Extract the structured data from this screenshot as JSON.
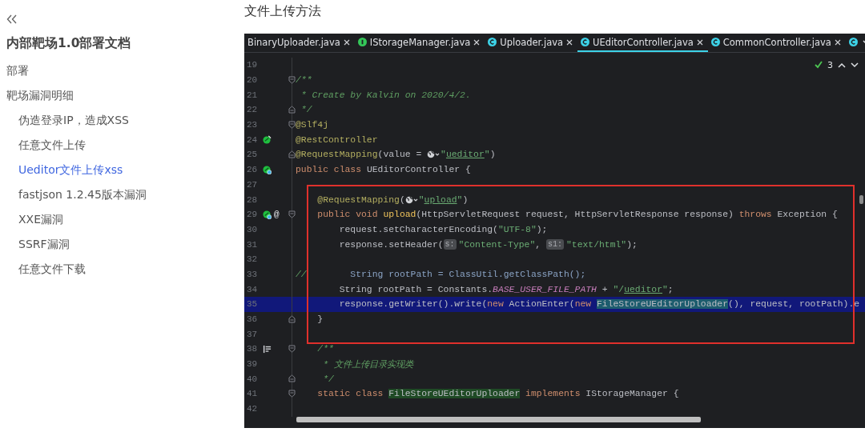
{
  "sidebar": {
    "title": "内部靶场1.0部署文档",
    "items": [
      {
        "label": "部署",
        "selected": false
      },
      {
        "label": "靶场漏洞明细",
        "selected": false,
        "children": [
          {
            "label": "伪造登录IP，造成XSS",
            "selected": false
          },
          {
            "label": "任意文件上传",
            "selected": false
          },
          {
            "label": "Ueditor文件上传xss",
            "selected": true
          },
          {
            "label": "fastjson 1.2.45版本漏洞",
            "selected": false
          },
          {
            "label": "XXE漏洞",
            "selected": false
          },
          {
            "label": "SSRF漏洞",
            "selected": false
          },
          {
            "label": "任意文件下载",
            "selected": false
          }
        ]
      }
    ]
  },
  "heading": "文件上传方法",
  "editor": {
    "tabs": [
      {
        "label": "BinaryUploader.java",
        "kind": "plain",
        "selected": false
      },
      {
        "label": "IStorageManager.java",
        "kind": "interface",
        "selected": false
      },
      {
        "label": "Uploader.java",
        "kind": "class",
        "selected": false
      },
      {
        "label": "UEditorController.java",
        "kind": "class",
        "selected": true
      },
      {
        "label": "CommonController.java",
        "kind": "class",
        "selected": false
      },
      {
        "kind": "class",
        "selected": false
      }
    ],
    "inspections": {
      "count": "3"
    },
    "lines": [
      {
        "number": "19",
        "selected": false
      },
      {
        "number": "20",
        "selected": false,
        "gutter": [
          {
            "kind": "fold-open"
          }
        ],
        "segments": [
          {
            "kind": "com",
            "text": "/**"
          }
        ]
      },
      {
        "number": "21",
        "selected": false,
        "segments": [
          {
            "kind": "com",
            "text": " * Create by Kalvin on 2020/4/2."
          }
        ]
      },
      {
        "number": "22",
        "selected": false,
        "gutter": [
          {
            "kind": "fold-close"
          }
        ],
        "segments": [
          {
            "kind": "com",
            "text": " */"
          }
        ]
      },
      {
        "number": "23",
        "selected": false,
        "gutter": [
          {
            "kind": "fold-open"
          }
        ],
        "segments": [
          {
            "kind": "ann",
            "text": "@Slf4j"
          }
        ]
      },
      {
        "number": "24",
        "selected": false,
        "gutter": [
          {
            "kind": "bean"
          }
        ],
        "segments": [
          {
            "kind": "ann",
            "text": "@RestController"
          }
        ]
      },
      {
        "number": "25",
        "selected": false,
        "gutter": [
          {
            "kind": "fold-close"
          }
        ],
        "segments": [
          {
            "kind": "ann",
            "text": "@RequestMapping"
          },
          {
            "kind": "plain",
            "text": "(value = "
          },
          {
            "kind": "globe"
          },
          {
            "kind": "str",
            "text": "\""
          },
          {
            "kind": "link",
            "text": "ueditor"
          },
          {
            "kind": "str",
            "text": "\""
          },
          {
            "kind": "plain",
            "text": ")"
          }
        ]
      },
      {
        "number": "26",
        "selected": false,
        "gutter": [
          {
            "kind": "bean-web"
          }
        ],
        "segments": [
          {
            "kind": "kw",
            "text": "public class "
          },
          {
            "kind": "plain",
            "text": "UEditorController {"
          }
        ]
      },
      {
        "number": "27",
        "selected": false
      },
      {
        "number": "28",
        "selected": false,
        "segments": [
          {
            "kind": "ann",
            "text": "    @RequestMapping"
          },
          {
            "kind": "plain",
            "text": "("
          },
          {
            "kind": "globe"
          },
          {
            "kind": "str",
            "text": "\""
          },
          {
            "kind": "link",
            "text": "upload"
          },
          {
            "kind": "str",
            "text": "\""
          },
          {
            "kind": "plain",
            "text": ")"
          }
        ]
      },
      {
        "number": "29",
        "selected": false,
        "gutter": [
          {
            "kind": "bean-web"
          },
          {
            "kind": "mark",
            "text": "@"
          },
          {
            "kind": "fold-open"
          }
        ],
        "segments": [
          {
            "kind": "kw",
            "text": "    public void "
          },
          {
            "kind": "fn",
            "text": "upload"
          },
          {
            "kind": "plain",
            "text": "(HttpServletRequest request, HttpServletResponse response) "
          },
          {
            "kind": "kw",
            "text": "throws"
          },
          {
            "kind": "plain",
            "text": " Exception {"
          }
        ]
      },
      {
        "number": "30",
        "selected": false,
        "segments": [
          {
            "kind": "plain",
            "text": "        request.setCharacterEncoding("
          },
          {
            "kind": "str",
            "text": "\"UTF-8\""
          },
          {
            "kind": "plain",
            "text": ");"
          }
        ]
      },
      {
        "number": "31",
        "selected": false,
        "segments": [
          {
            "kind": "plain",
            "text": "        response.setHeader("
          },
          {
            "kind": "hint",
            "text": "s:"
          },
          {
            "kind": "str",
            "text": "\"Content-Type\""
          },
          {
            "kind": "plain",
            "text": ", "
          },
          {
            "kind": "hint",
            "text": "s1:"
          },
          {
            "kind": "str",
            "text": "\"text/html\""
          },
          {
            "kind": "plain",
            "text": ");"
          }
        ]
      },
      {
        "number": "32",
        "selected": false
      },
      {
        "number": "33",
        "selected": false,
        "segments": [
          {
            "kind": "com",
            "text": "//"
          },
          {
            "kind": "dim",
            "text": "        String rootPath = ClassUtil.getClassPath();"
          }
        ]
      },
      {
        "number": "34",
        "selected": false,
        "segments": [
          {
            "kind": "plain",
            "text": "        String rootPath = Constants."
          },
          {
            "kind": "const",
            "text": "BASE_USER_FILE_PATH"
          },
          {
            "kind": "plain",
            "text": " + "
          },
          {
            "kind": "str",
            "text": "\"/"
          },
          {
            "kind": "link",
            "text": "ueditor"
          },
          {
            "kind": "str",
            "text": "\""
          },
          {
            "kind": "plain",
            "text": ";"
          }
        ]
      },
      {
        "number": "35",
        "selected": true,
        "segments": [
          {
            "kind": "plain",
            "text": "        response.getWriter().write("
          },
          {
            "kind": "kw",
            "text": "new"
          },
          {
            "kind": "plain",
            "text": " ActionEnter("
          },
          {
            "kind": "kw",
            "text": "new "
          },
          {
            "kind": "match",
            "text": "FileStoreUEditorUploader"
          },
          {
            "kind": "plain",
            "text": "(), request, rootPath).e"
          }
        ]
      },
      {
        "number": "36",
        "selected": false,
        "gutter": [
          {
            "kind": "fold-close"
          }
        ],
        "segments": [
          {
            "kind": "plain",
            "text": "    }"
          }
        ]
      },
      {
        "number": "37",
        "selected": false
      },
      {
        "number": "38",
        "selected": false,
        "gutter": [
          {
            "kind": "doc"
          },
          {
            "kind": "fold-open"
          }
        ],
        "segments": [
          {
            "kind": "com",
            "text": "    /**"
          }
        ]
      },
      {
        "number": "39",
        "selected": false,
        "segments": [
          {
            "kind": "com",
            "text": "     * 文件上传目录实现类"
          }
        ]
      },
      {
        "number": "40",
        "selected": false,
        "gutter": [
          {
            "kind": "fold-close"
          }
        ],
        "segments": [
          {
            "kind": "com",
            "text": "     */"
          }
        ]
      },
      {
        "number": "41",
        "selected": false,
        "gutter": [
          {
            "kind": "fold-open"
          }
        ],
        "segments": [
          {
            "kind": "kw",
            "text": "    static class "
          },
          {
            "kind": "decl",
            "text": "FileStoreUEditorUploader"
          },
          {
            "kind": "kw",
            "text": " implements"
          },
          {
            "kind": "plain",
            "text": " IStorageManager {"
          }
        ]
      },
      {
        "number": "42",
        "selected": false
      }
    ]
  }
}
